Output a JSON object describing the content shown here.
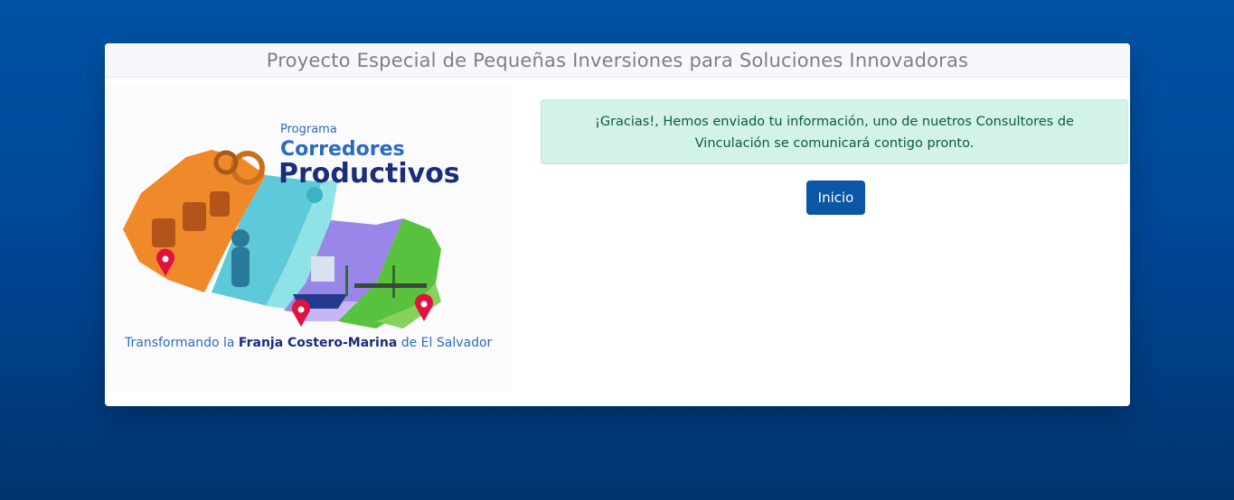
{
  "header": {
    "title": "Proyecto Especial de Pequeñas Inversiones para Soluciones Innovadoras"
  },
  "logo": {
    "program_label": "Programa",
    "name_line1": "Corredores",
    "name_line2": "Productivos",
    "tagline_part1": "Transformando la ",
    "tagline_bold": "Franja Costero-Marina",
    "tagline_part2": " de El Salvador"
  },
  "alert": {
    "message": "¡Gracias!, Hemos enviado tu información, uno de nuetros Consultores de Vinculación se comunicará contigo pronto."
  },
  "actions": {
    "home_label": "Inicio"
  }
}
